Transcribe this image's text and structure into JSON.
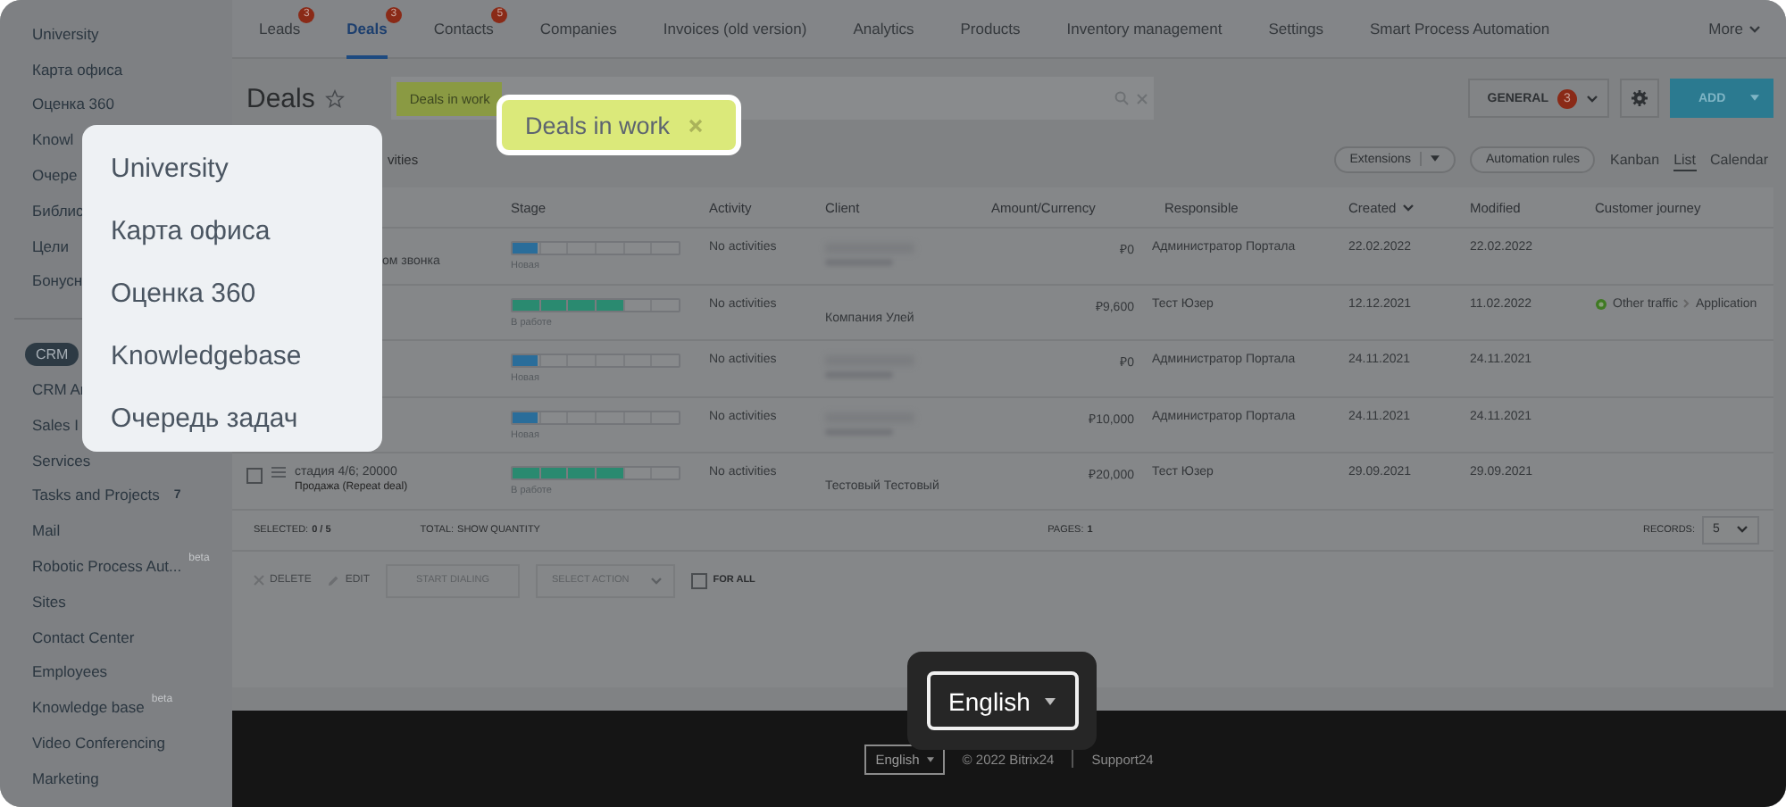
{
  "sidebar": {
    "groups": [
      {
        "items": [
          {
            "label": "University",
            "selected": false
          },
          {
            "label": "Карта офиса",
            "selected": false
          },
          {
            "label": "Оценка 360",
            "selected": false
          },
          {
            "label": "Knowl",
            "selected": false
          },
          {
            "label": "Очере",
            "selected": false
          },
          {
            "label": "Библис",
            "selected": false
          },
          {
            "label": "Цели",
            "selected": false
          },
          {
            "label": "Бонусн",
            "selected": false
          }
        ]
      },
      {
        "items": [
          {
            "label": "CRM",
            "selected": true
          },
          {
            "label": "CRM Ar",
            "selected": false
          },
          {
            "label": "Sales I",
            "selected": false
          },
          {
            "label": "Services",
            "selected": false
          },
          {
            "label": "Tasks and Projects",
            "selected": false,
            "counter": "7"
          },
          {
            "label": "Mail",
            "selected": false
          },
          {
            "label": "Robotic Process Aut...",
            "selected": false,
            "tag": "beta"
          },
          {
            "label": "Sites",
            "selected": false
          },
          {
            "label": "Contact Center",
            "selected": false
          },
          {
            "label": "Employees",
            "selected": false
          },
          {
            "label": "Knowledge base",
            "selected": false,
            "tag": "beta"
          },
          {
            "label": "Video Conferencing",
            "selected": false
          },
          {
            "label": "Marketing",
            "selected": false
          }
        ]
      }
    ]
  },
  "nav": {
    "tabs": [
      {
        "label": "Leads",
        "selected": false,
        "badge": "3"
      },
      {
        "label": "Deals",
        "selected": true,
        "badge": "3"
      },
      {
        "label": "Contacts",
        "selected": false,
        "badge": "5"
      },
      {
        "label": "Companies",
        "selected": false
      },
      {
        "label": "Invoices (old version)",
        "selected": false
      },
      {
        "label": "Analytics",
        "selected": false
      },
      {
        "label": "Products",
        "selected": false
      },
      {
        "label": "Inventory management",
        "selected": false
      },
      {
        "label": "Settings",
        "selected": false
      },
      {
        "label": "Smart Process Automation",
        "selected": false
      }
    ],
    "more": "More"
  },
  "toolbar": {
    "title": "Deals",
    "filter_tag": "Deals in work",
    "category": "GENERAL",
    "category_badge": "3",
    "add": "ADD"
  },
  "subbar": {
    "left_text": "vities",
    "extensions": "Extensions",
    "automation": "Automation rules",
    "views": [
      {
        "label": "Kanban",
        "selected": false
      },
      {
        "label": "List",
        "selected": true
      },
      {
        "label": "Calendar",
        "selected": false
      }
    ]
  },
  "table": {
    "columns": [
      {
        "label": "Stage"
      },
      {
        "label": "Activity"
      },
      {
        "label": "Client"
      },
      {
        "label": "Amount/Currency"
      },
      {
        "label": "Responsible"
      },
      {
        "label": "Created",
        "sorted": true
      },
      {
        "label": "Modified"
      },
      {
        "label": "Customer journey"
      }
    ],
    "rows": [
      {
        "kind": "partial",
        "title": "ом звонка",
        "stage": {
          "label": "Новая",
          "level": 0.15,
          "color": "#2a6d9a"
        },
        "activity": "No activities",
        "client": {
          "kind": "blurred"
        },
        "amount": "₽0",
        "responsible": "Администратор Портала",
        "created": "22.02.2022",
        "modified": "22.02.2022"
      },
      {
        "kind": "partial",
        "stage": {
          "label": "В работе",
          "level": 0.67,
          "color": "#2a8a70"
        },
        "activity": "No activities",
        "client": {
          "kind": "text",
          "text": "Компания Улей"
        },
        "amount": "₽9,600",
        "responsible": "Тест Юзер",
        "created": "12.12.2021",
        "modified": "11.02.2022",
        "journey": [
          "Other traffic",
          "Application"
        ]
      },
      {
        "kind": "partial",
        "stage": {
          "label": "Новая",
          "level": 0.15,
          "color": "#2a6d9a"
        },
        "activity": "No activities",
        "client": {
          "kind": "blurred"
        },
        "amount": "₽0",
        "responsible": "Администратор Портала",
        "created": "24.11.2021",
        "modified": "24.11.2021"
      },
      {
        "kind": "partial",
        "stage": {
          "label": "Новая",
          "level": 0.15,
          "color": "#2a6d9a"
        },
        "activity": "No activities",
        "client": {
          "kind": "blurred"
        },
        "amount": "₽10,000",
        "responsible": "Администратор Портала",
        "created": "24.11.2021",
        "modified": "24.11.2021"
      },
      {
        "kind": "full",
        "checked": false,
        "title": "стадия 4/6; 20000",
        "subtitle": "Продажа (Repeat deal)",
        "stage": {
          "label": "В работе",
          "level": 0.67,
          "color": "#2a8a70"
        },
        "activity": "No activities",
        "client": {
          "kind": "text",
          "text": "Тестовый Тестовый"
        },
        "amount": "₽20,000",
        "responsible": "Тест Юзер",
        "created": "29.09.2021",
        "modified": "29.09.2021"
      }
    ],
    "summary": {
      "selected_label": "SELECTED:",
      "selected_value": "0 / 5",
      "total_label": "TOTAL:",
      "total_value": "SHOW QUANTITY",
      "pages_label": "PAGES:",
      "pages_value": "1",
      "records_label": "RECORDS:",
      "records_value": "5"
    },
    "actions": {
      "delete": "DELETE",
      "edit": "EDIT",
      "dial": "START DIALING",
      "select_action": "SELECT ACTION",
      "for_all": "FOR ALL",
      "for_all_checked": false
    }
  },
  "footer": {
    "language": "English",
    "copyright": "© 2022 Bitrix24",
    "support": "Support24"
  },
  "callouts": {
    "menu": [
      "University",
      "Карта офиса",
      "Оценка 360",
      "Knowledgebase",
      "Очередь задач"
    ],
    "filter_tag": "Deals in work",
    "language": "English"
  }
}
